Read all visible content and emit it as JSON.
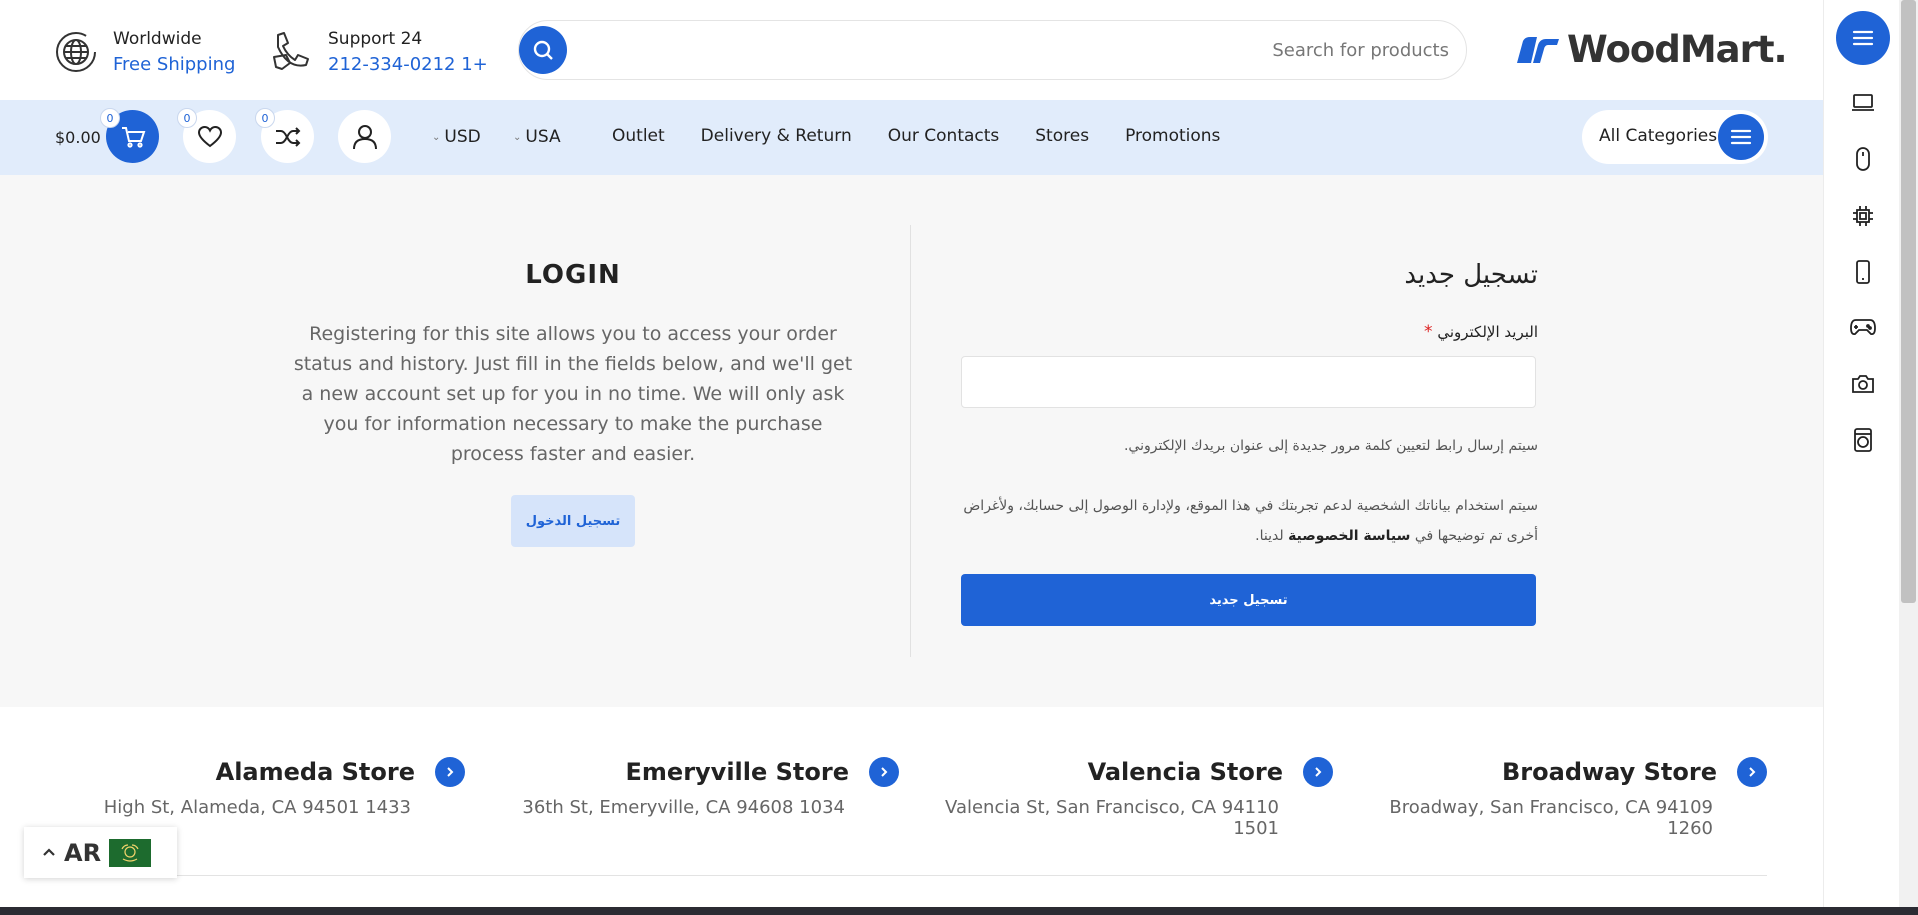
{
  "header": {
    "shipping": {
      "line1": "Worldwide",
      "line2": "Free Shipping"
    },
    "support": {
      "line1": "Support 24",
      "line2": "212-334-0212 1+"
    },
    "search": {
      "placeholder": "Search for products"
    },
    "logo": {
      "text": "WoodMart."
    }
  },
  "nav": {
    "cart_amount": "$0.00",
    "cart_count": "0",
    "wishlist_count": "0",
    "compare_count": "0",
    "currency": "USD",
    "country": "USA",
    "links": [
      "Outlet",
      "Delivery & Return",
      "Our Contacts",
      "Stores",
      "Promotions"
    ],
    "all_categories": "All Categories"
  },
  "login": {
    "title": "LOGIN",
    "description": "Registering for this site allows you to access your order status and history. Just fill in the fields below, and we'll get a new account set up for you in no time. We will only ask you for information necessary to make the purchase process faster and easier.",
    "button": "تسجيل الدخول"
  },
  "register": {
    "title": "تسجيل جديد",
    "email_label": "البريد الإلكتروني",
    "required_mark": "*",
    "email_value": "",
    "note1": "سيتم إرسال رابط لتعيين كلمة مرور جديدة إلى عنوان بريدك الإلكتروني.",
    "note2_part1": "سيتم استخدام بياناتك الشخصية لدعم تجربتك في هذا الموقع، ولإدارة الوصول إلى حسابك، ولأغراض أخرى تم توضيحها في",
    "note2_link": "سياسة الخصوصية",
    "note2_part2": "لدينا.",
    "button": "تسجيل جديد"
  },
  "stores": [
    {
      "name": "Alameda Store",
      "address": "High St, Alameda, CA 94501 1433"
    },
    {
      "name": "Emeryville Store",
      "address": "36th St, Emeryville, CA 94608 1034"
    },
    {
      "name": "Valencia Store",
      "address": "Valencia St, San Francisco, CA 94110 1501"
    },
    {
      "name": "Broadway Store",
      "address": "Broadway, San Francisco, CA 94109 1260"
    }
  ],
  "language": {
    "code": "AR"
  },
  "colors": {
    "accent": "#1f63d6",
    "nav_bg": "#e1ecfb",
    "main_bg": "#f7f7f7"
  },
  "sidebar_icons": [
    "laptop-icon",
    "mouse-icon",
    "cpu-icon",
    "phone-icon",
    "gamepad-icon",
    "camera-icon",
    "washer-icon"
  ]
}
